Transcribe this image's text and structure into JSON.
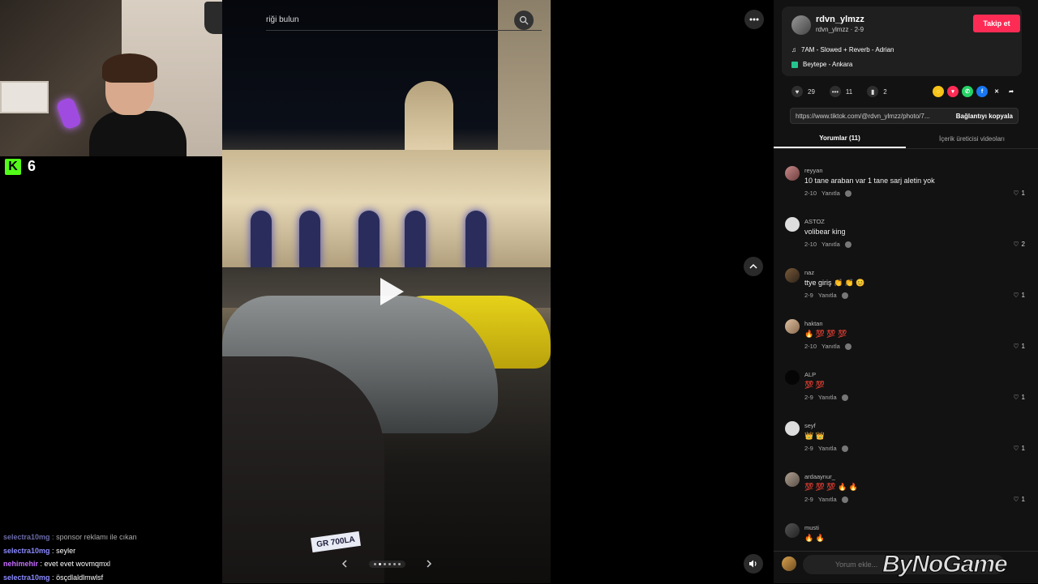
{
  "stream": {
    "viewer_count": "6",
    "chat": [
      {
        "user": "selectra10mg",
        "message": "sponsor reklamı ile cıkan",
        "color": "#6a6aa8"
      },
      {
        "user": "selectra10mg",
        "message": "seyler",
        "color": "#8a8aff"
      },
      {
        "user": "nehimehir",
        "message": "evet evet wovmqmxl",
        "color": "#c56cff"
      },
      {
        "user": "selectra10mg",
        "message": "ösçdlaldlmwlsf",
        "color": "#8a8aff"
      }
    ]
  },
  "search": {
    "text": "riği bulun"
  },
  "post": {
    "username": "rdvn_ylmzz",
    "subline": "rdvn_ylmzz · 2-9",
    "follow_label": "Takip et",
    "music": "7AM - Slowed + Reverb - Adrian",
    "location": "Beytepe - Ankara",
    "likes": "29",
    "comments_count": "11",
    "saves": "2",
    "url": "https://www.tiktok.com/@rdvn_ylmzz/photo/7...",
    "copy_label": "Bağlantıyı kopyala",
    "plate": "GR 700LA"
  },
  "tabs": [
    {
      "label": "Yorumlar (11)"
    },
    {
      "label": "İçerik üreticisi videoları"
    }
  ],
  "comments": [
    {
      "user": "reyyan",
      "text": "10 tane araban var 1 tane sarj aletin yok",
      "date": "2-10",
      "reply": "Yanıtla",
      "likes": "1"
    },
    {
      "user": "ASTOZ",
      "text": "volibear king",
      "date": "2-10",
      "reply": "Yanıtla",
      "likes": "2"
    },
    {
      "user": "naz",
      "text": "ttye giriş 👏 👏 😊",
      "date": "2-9",
      "reply": "Yanıtla",
      "likes": "1"
    },
    {
      "user": "haktan",
      "text": "🔥 💯 💯 💯",
      "date": "2-10",
      "reply": "Yanıtla",
      "likes": "1"
    },
    {
      "user": "ALP",
      "text": "💯 💯",
      "date": "2-9",
      "reply": "Yanıtla",
      "likes": "1"
    },
    {
      "user": "seyf",
      "text": "👑 👑",
      "date": "2-9",
      "reply": "Yanıtla",
      "likes": "1"
    },
    {
      "user": "ardaaynur_",
      "text": "💯 💯 💯 🔥 🔥",
      "date": "2-9",
      "reply": "Yanıtla",
      "likes": "1"
    },
    {
      "user": "musti",
      "text": "🔥 🔥",
      "date": "",
      "reply": "",
      "likes": ""
    }
  ],
  "input": {
    "placeholder": "Yorum ekle..."
  },
  "watermark": "ByNoGame",
  "colors": {
    "accent": "#fe2c55",
    "kick": "#53fc18"
  }
}
